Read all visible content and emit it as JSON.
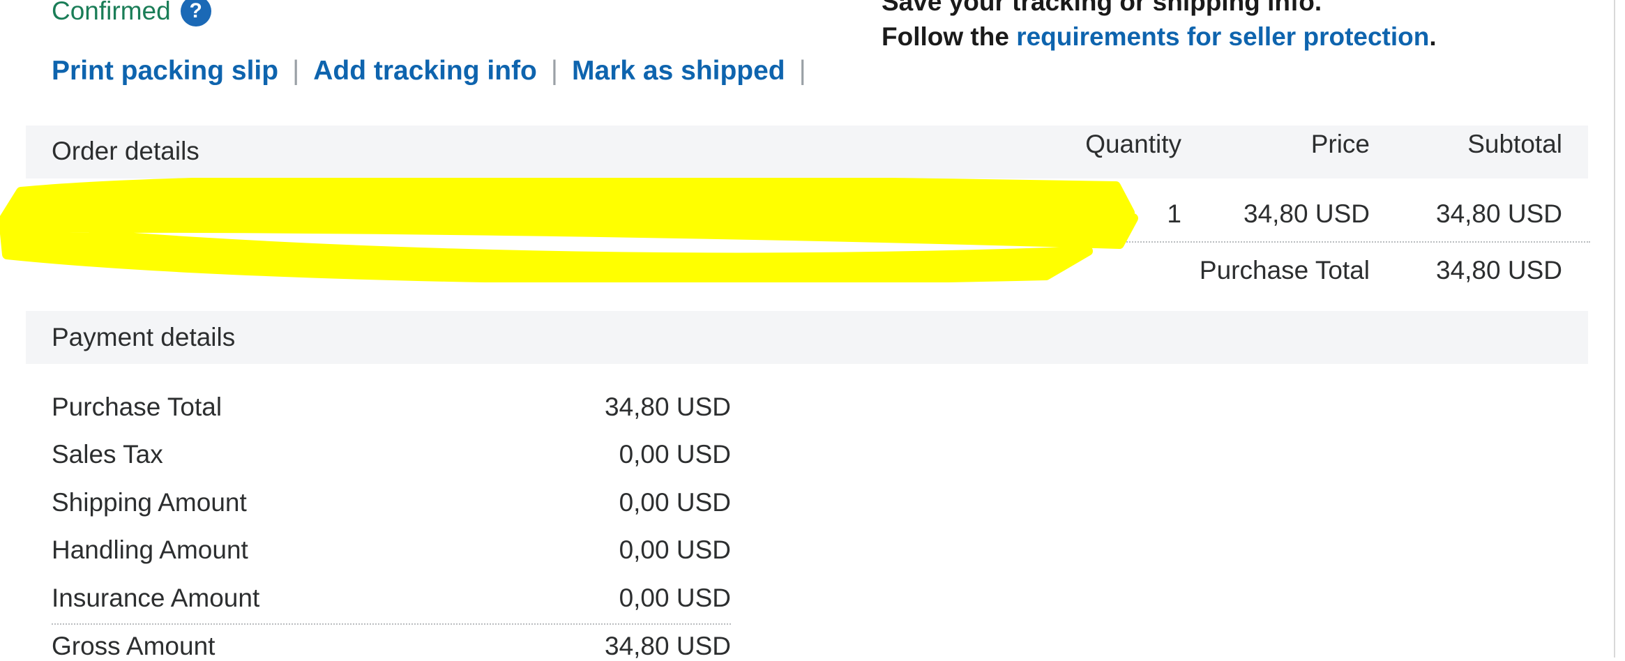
{
  "status": {
    "text": "Confirmed",
    "help_glyph": "?"
  },
  "actions": {
    "print_packing_slip": "Print packing slip",
    "add_tracking_info": "Add tracking info",
    "mark_as_shipped": "Mark as shipped",
    "separator": "|"
  },
  "shipping_info": {
    "line1": "Save your tracking or shipping info.",
    "line2_prefix": "Follow the ",
    "line2_link": "requirements for seller protection",
    "line2_suffix": "."
  },
  "order_details": {
    "header": "Order details",
    "columns": {
      "quantity": "Quantity",
      "price": "Price",
      "subtotal": "Subtotal"
    },
    "item": {
      "quantity": "1",
      "price": "34,80 USD",
      "subtotal": "34,80 USD"
    },
    "purchase_total_label": "Purchase Total",
    "purchase_total_value": "34,80 USD"
  },
  "payment_details": {
    "header": "Payment details",
    "rows": [
      {
        "label": "Purchase Total",
        "value": "34,80 USD"
      },
      {
        "label": "Sales Tax",
        "value": "0,00 USD"
      },
      {
        "label": "Shipping Amount",
        "value": "0,00 USD"
      },
      {
        "label": "Handling Amount",
        "value": "0,00 USD"
      },
      {
        "label": "Insurance Amount",
        "value": "0,00 USD"
      },
      {
        "label": "Gross Amount",
        "value": "34,80 USD"
      }
    ]
  },
  "colors": {
    "link": "#0e64ae",
    "confirmed": "#1a7d57",
    "band": "#f4f5f7",
    "redaction": "#ffff00"
  }
}
